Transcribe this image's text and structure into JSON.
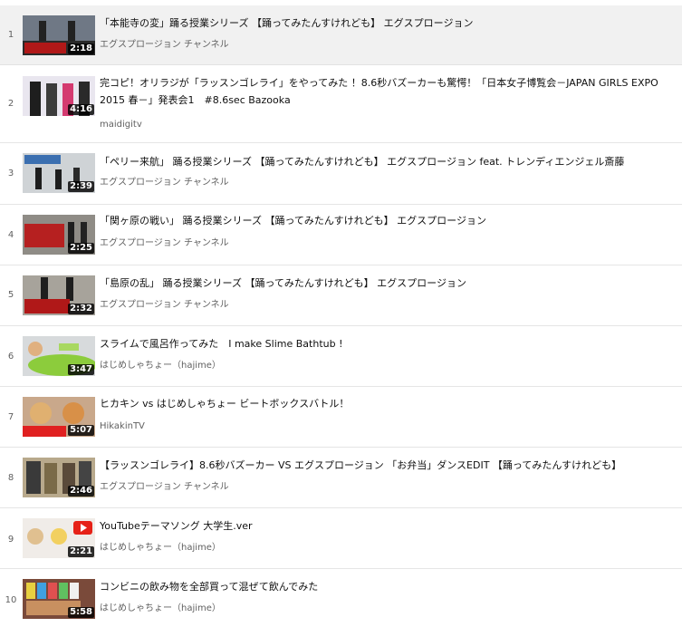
{
  "playlist": {
    "items": [
      {
        "index": "1",
        "title": "「本能寺の変」踊る授業シリーズ 【踊ってみたんすけれども】 エグスプロージョン",
        "channel": "エグスプロージョン チャンネル",
        "duration": "2:18"
      },
      {
        "index": "2",
        "title": "完コピ！オリラジが「ラッスンゴレライ」をやってみた ！8.6秒バズーカーも驚愕！「日本女子博覧会－JAPAN GIRLS EXPO 2015 春－」発表会1　#8.6sec Bazooka",
        "channel": "maidigitv",
        "duration": "4:16"
      },
      {
        "index": "3",
        "title": "「ペリー来航」 踊る授業シリーズ 【踊ってみたんすけれども】 エグスプロージョン feat. トレンディエンジェル斎藤",
        "channel": "エグスプロージョン チャンネル",
        "duration": "2:39"
      },
      {
        "index": "4",
        "title": "「関ヶ原の戦い」 踊る授業シリーズ 【踊ってみたんすけれども】 エグスプロージョン",
        "channel": "エグスプロージョン チャンネル",
        "duration": "2:25"
      },
      {
        "index": "5",
        "title": "「島原の乱」 踊る授業シリーズ 【踊ってみたんすけれども】 エグスプロージョン",
        "channel": "エグスプロージョン チャンネル",
        "duration": "2:32"
      },
      {
        "index": "6",
        "title": "スライムで風呂作ってみた　I make Slime Bathtub !",
        "channel": "はじめしゃちょー（hajime）",
        "duration": "3:47"
      },
      {
        "index": "7",
        "title": "ヒカキン vs はじめしゃちょー ビートボックスバトル！",
        "channel": "HikakinTV",
        "duration": "5:07"
      },
      {
        "index": "8",
        "title": "【ラッスンゴレライ】8.6秒バズーカー VS エグスプロージョン 「お弁当」ダンスEDIT 【踊ってみたんすけれども】",
        "channel": "エグスプロージョン チャンネル",
        "duration": "2:46"
      },
      {
        "index": "9",
        "title": "YouTubeテーマソング 大学生.ver",
        "channel": "はじめしゃちょー（hajime）",
        "duration": "2:21"
      },
      {
        "index": "10",
        "title": "コンビニの飲み物を全部買って混ぜて飲んでみた",
        "channel": "はじめしゃちょー（hajime）",
        "duration": "5:58"
      }
    ]
  }
}
